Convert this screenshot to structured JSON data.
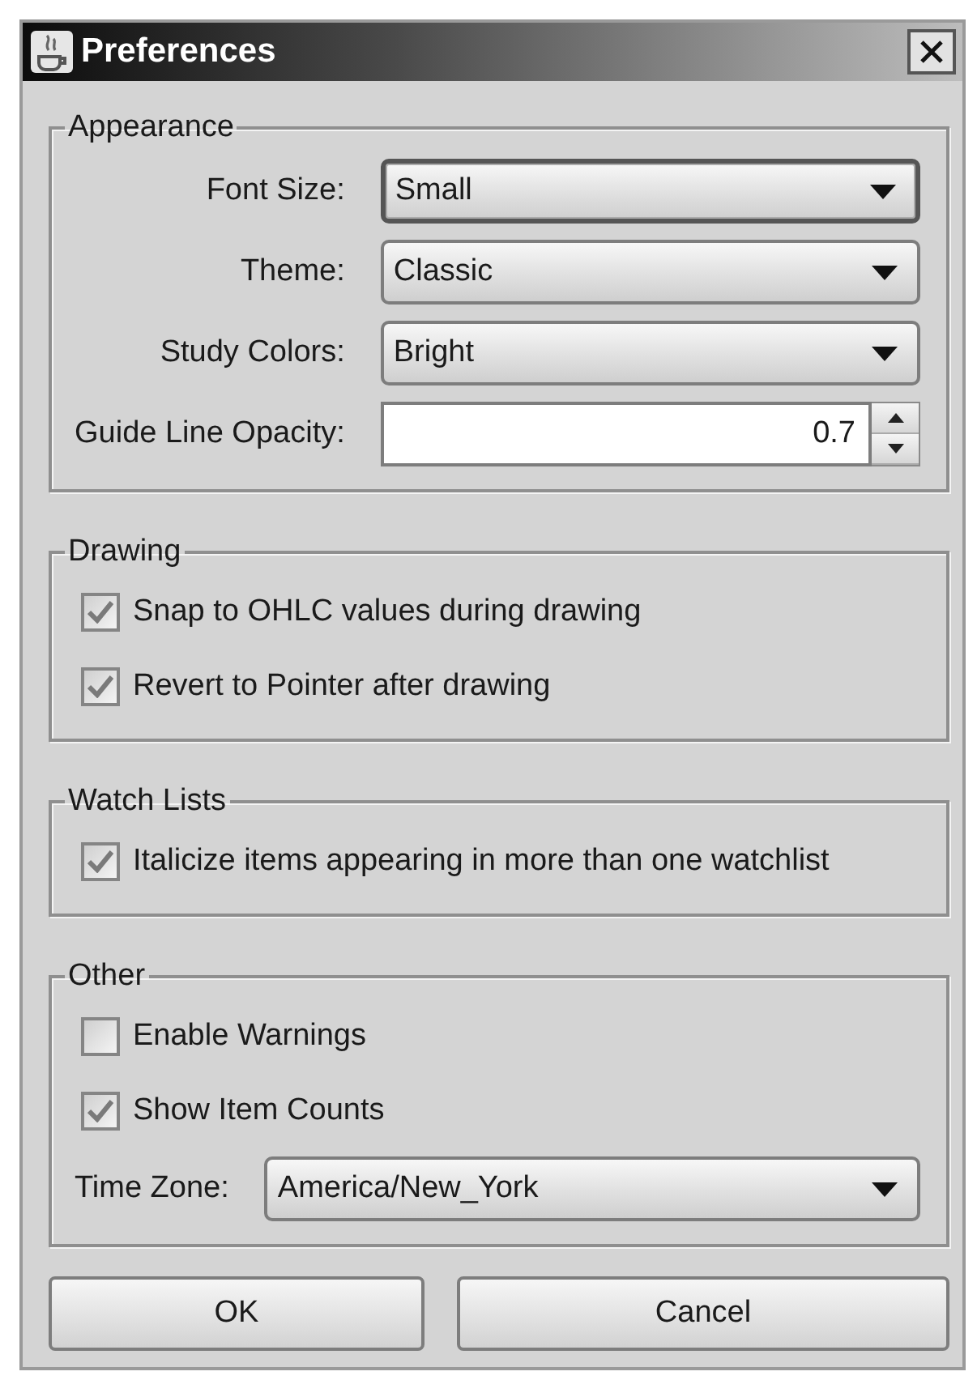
{
  "window": {
    "title": "Preferences"
  },
  "groups": [
    {
      "title": "Appearance",
      "items": [
        {
          "kind": "dropdown",
          "label": "Font Size:",
          "value": "Small",
          "focused": true
        },
        {
          "kind": "dropdown",
          "label": "Theme:",
          "value": "Classic",
          "focused": false
        },
        {
          "kind": "dropdown",
          "label": "Study Colors:",
          "value": "Bright",
          "focused": false
        },
        {
          "kind": "spinner",
          "label": "Guide Line Opacity:",
          "value": "0.7"
        }
      ]
    },
    {
      "title": "Drawing",
      "items": [
        {
          "kind": "checkbox",
          "label": "Snap to OHLC values during drawing",
          "checked": true
        },
        {
          "kind": "checkbox",
          "label": "Revert to Pointer after drawing",
          "checked": true
        }
      ]
    },
    {
      "title": "Watch Lists",
      "items": [
        {
          "kind": "checkbox",
          "label": "Italicize items appearing in more than one watchlist",
          "checked": true
        }
      ]
    },
    {
      "title": "Other",
      "items": [
        {
          "kind": "checkbox",
          "label": "Enable Warnings",
          "checked": false
        },
        {
          "kind": "checkbox",
          "label": "Show Item Counts",
          "checked": true
        },
        {
          "kind": "dropdown",
          "label": "Time Zone:",
          "value": "America/New_York",
          "focused": false
        }
      ]
    }
  ],
  "buttons": [
    {
      "label": "OK"
    },
    {
      "label": "Cancel"
    }
  ]
}
